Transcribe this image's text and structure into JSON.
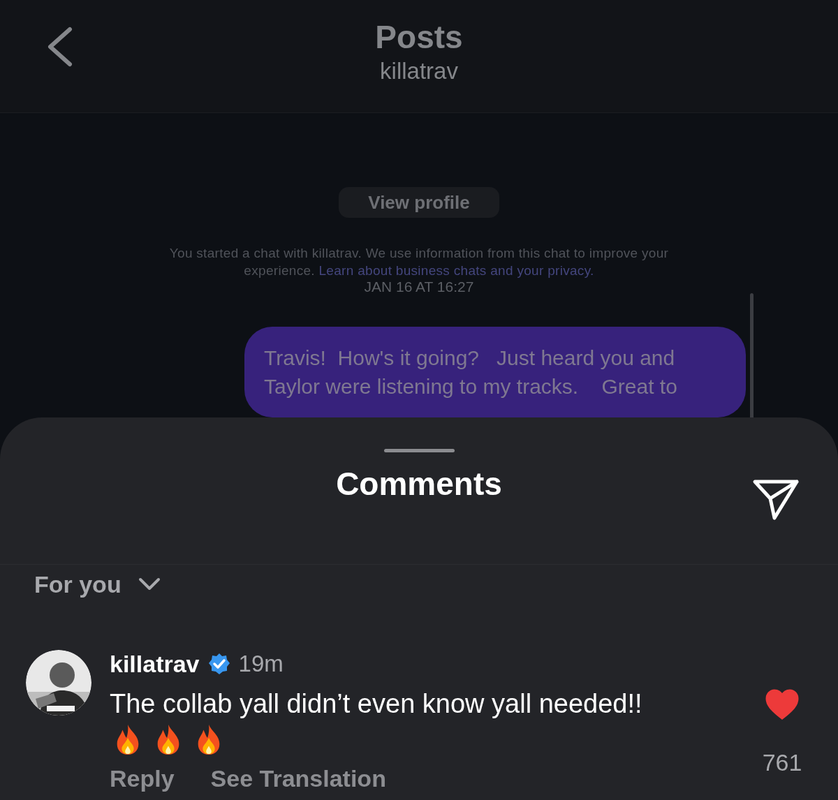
{
  "header": {
    "title": "Posts",
    "subtitle": "killatrav"
  },
  "chat": {
    "button": "View profile",
    "notice": "You started a chat with killatrav. We use information from this chat to improve your experience.",
    "notice_link": "Learn about business chats and your privacy.",
    "timestamp": "JAN 16 AT 16:27",
    "message_lines": [
      "Travis!  How's it going?   Just heard you and",
      "Taylor were listening to my tracks.    Great to"
    ]
  },
  "sheet": {
    "title": "Comments",
    "sort": "For you",
    "comments": [
      {
        "kind": "picture",
        "username": "killatrav",
        "verified": true,
        "time": "19m",
        "text": "The collab yall didn’t even know yall needed!!",
        "liked": true,
        "likes": "761",
        "actions": [
          "Reply",
          "See Translation"
        ]
      }
    ]
  }
}
